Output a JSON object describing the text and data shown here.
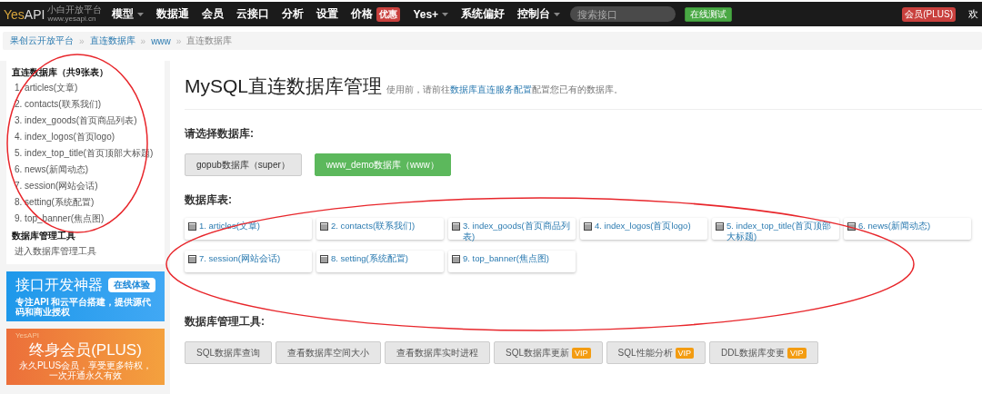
{
  "navbar": {
    "logo": {
      "brand_a": "Yes",
      "brand_b": "API",
      "tagline": "小白开放平台",
      "url": "www.yesapi.cn"
    },
    "menu": [
      {
        "label": "模型",
        "dropdown": true
      },
      {
        "label": "数据通",
        "dropdown": false
      },
      {
        "label": "会员",
        "dropdown": false
      },
      {
        "label": "云接口",
        "dropdown": false
      },
      {
        "label": "分析",
        "dropdown": false
      },
      {
        "label": "设置",
        "dropdown": false
      },
      {
        "label": "价格",
        "dropdown": false,
        "badge": "优惠"
      },
      {
        "label": "Yes+",
        "dropdown": true
      },
      {
        "label": "系统偏好",
        "dropdown": false
      },
      {
        "label": "控制台",
        "dropdown": true
      }
    ],
    "search": {
      "placeholder": "搜索接口"
    },
    "test_button": "在线测试",
    "plus_badge": "会员(PLUS)",
    "greeting": "欢"
  },
  "breadcrumb": {
    "separator": "»",
    "items": [
      {
        "label": "果创云开放平台",
        "link": true
      },
      {
        "label": "直连数据库",
        "link": true
      },
      {
        "label": "www",
        "link": true
      },
      {
        "label": "直连数据库",
        "link": false
      }
    ]
  },
  "sidebar": {
    "sections": [
      {
        "title": "直连数据库（共9张表）",
        "items": [
          "1. articles(文章)",
          "2. contacts(联系我们)",
          "3. index_goods(首页商品列表)",
          "4. index_logos(首页logo)",
          "5. index_top_title(首页顶部大标题)",
          "6. news(新闻动态)",
          "7. session(网站会话)",
          "8. setting(系统配置)",
          "9. top_banner(焦点图)"
        ]
      },
      {
        "title": "数据库管理工具",
        "items": [
          "进入数据库管理工具"
        ]
      }
    ],
    "banners": [
      {
        "kind": "blue",
        "title": "接口开发神器",
        "button": "在线体验",
        "text": "专注API 和云平台搭建，提供源代码和商业授权"
      },
      {
        "kind": "orange",
        "logo": "YesAPI",
        "title": "终身会员(PLUS)",
        "text": "永久PLUS会员，享受更多特权，一次开通永久有效"
      }
    ]
  },
  "main": {
    "title": "MySQL直连数据库管理",
    "hint_before": "使用前，请前往",
    "hint_link": "数据库直连服务配置",
    "hint_after": "配置您已有的数据库。",
    "databases": {
      "label": "请选择数据库:",
      "buttons": [
        {
          "label": "gopub数据库（super）",
          "selected": false
        },
        {
          "label": "www_demo数据库（www）",
          "selected": true
        }
      ]
    },
    "tables": {
      "label": "数据库表:",
      "items": [
        "1. articles(文章)",
        "2. contacts(联系我们)",
        "3. index_goods(首页商品列表)",
        "4. index_logos(首页logo)",
        "5. index_top_title(首页顶部大标题)",
        "6. news(新闻动态)",
        "7. session(网站会话)",
        "8. setting(系统配置)",
        "9. top_banner(焦点图)"
      ]
    },
    "tools": {
      "label": "数据库管理工具:",
      "buttons": [
        {
          "label": "SQL数据库查询"
        },
        {
          "label": "查看数据库空间大小"
        },
        {
          "label": "查看数据库实时进程"
        },
        {
          "label": "SQL数据库更新",
          "badge": "VIP"
        },
        {
          "label": "SQL性能分析",
          "badge": "VIP"
        },
        {
          "label": "DDL数据库变更",
          "badge": "VIP"
        }
      ]
    }
  },
  "annotations": [
    {
      "kind": "ellipse"
    },
    {
      "kind": "ellipse"
    }
  ]
}
